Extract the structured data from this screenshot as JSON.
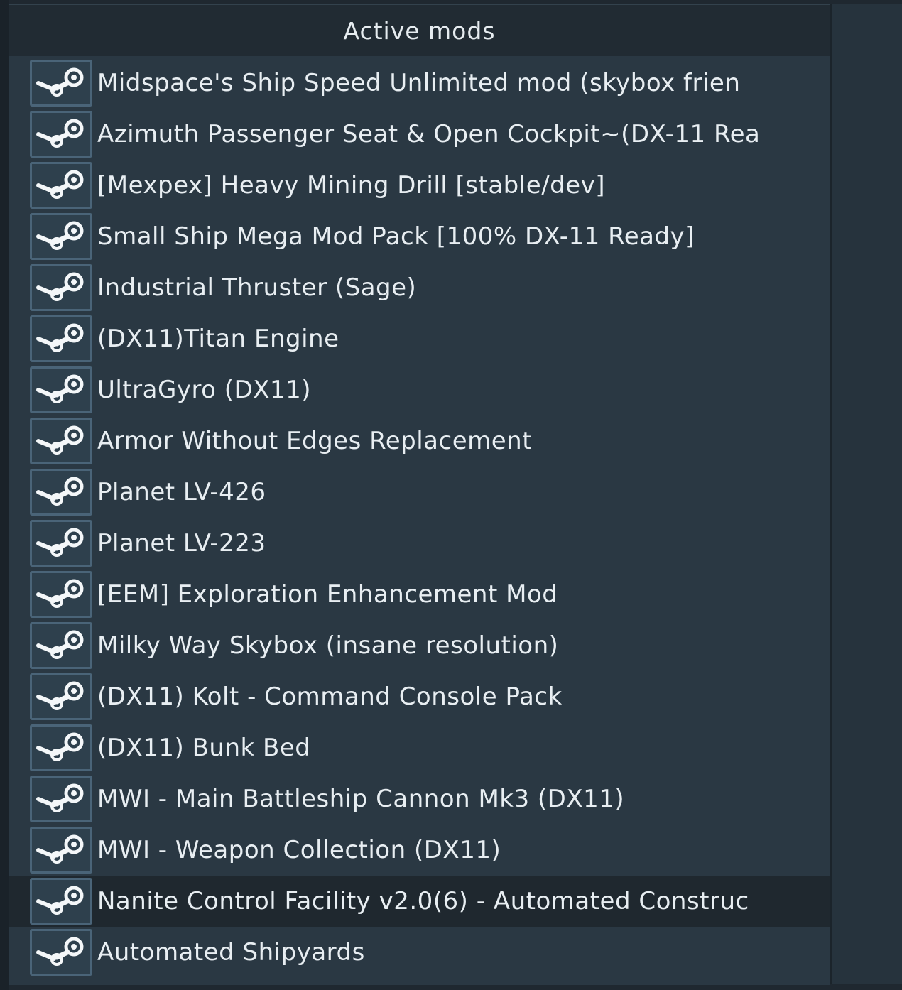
{
  "panel": {
    "title": "Active mods"
  },
  "mods": [
    {
      "name": "Midspace's Ship Speed Unlimited mod (skybox frien",
      "icon": "steam-icon"
    },
    {
      "name": "Azimuth Passenger Seat & Open Cockpit~(DX-11 Rea",
      "icon": "steam-icon"
    },
    {
      "name": "[Mexpex] Heavy Mining Drill [stable/dev]",
      "icon": "steam-icon"
    },
    {
      "name": "Small Ship Mega Mod Pack [100% DX-11 Ready]",
      "icon": "steam-icon"
    },
    {
      "name": "Industrial Thruster (Sage)",
      "icon": "steam-icon"
    },
    {
      "name": "(DX11)Titan Engine",
      "icon": "steam-icon"
    },
    {
      "name": "UltraGyro (DX11)",
      "icon": "steam-icon"
    },
    {
      "name": "Armor Without Edges Replacement",
      "icon": "steam-icon"
    },
    {
      "name": "Planet LV-426",
      "icon": "steam-icon"
    },
    {
      "name": "Planet LV-223",
      "icon": "steam-icon"
    },
    {
      "name": "[EEM] Exploration Enhancement Mod",
      "icon": "steam-icon"
    },
    {
      "name": "Milky Way Skybox (insane resolution)",
      "icon": "steam-icon"
    },
    {
      "name": "(DX11) Kolt - Command Console Pack",
      "icon": "steam-icon"
    },
    {
      "name": "(DX11) Bunk Bed",
      "icon": "steam-icon"
    },
    {
      "name": "MWI - Main Battleship Cannon Mk3 (DX11)",
      "icon": "steam-icon"
    },
    {
      "name": "MWI - Weapon Collection (DX11)",
      "icon": "steam-icon"
    },
    {
      "name": "Nanite Control Facility v2.0(6) - Automated Construc",
      "icon": "steam-icon",
      "highlighted": true
    },
    {
      "name": "Automated Shipyards",
      "icon": "steam-icon"
    }
  ]
}
